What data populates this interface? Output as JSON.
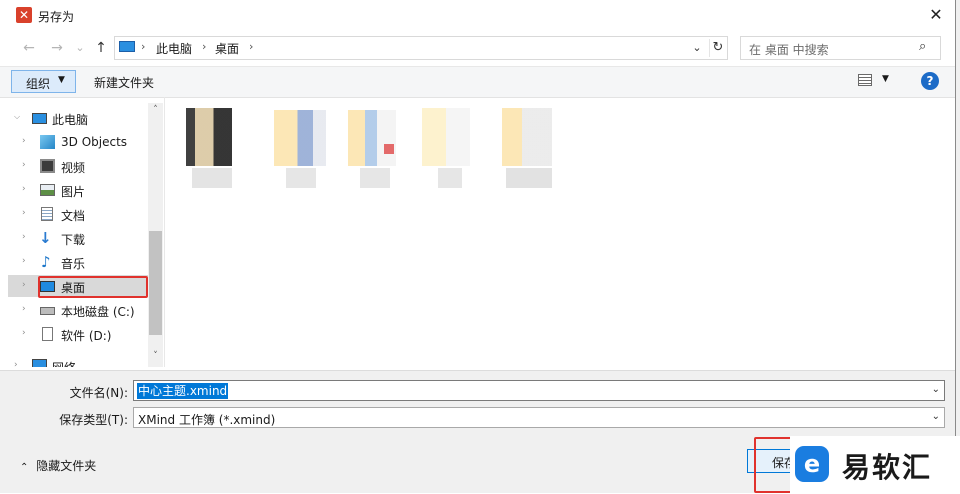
{
  "window": {
    "title": "另存为",
    "close": "✕"
  },
  "nav": {
    "back": "←",
    "forward": "→",
    "dropdown": "⌄",
    "up": "↑"
  },
  "address": {
    "crumbs": [
      "此电脑",
      "桌面"
    ],
    "sep": "›",
    "refresh": "↻",
    "dropdown": "⌄"
  },
  "search": {
    "placeholder": "在 桌面 中搜索",
    "icon": "⌕"
  },
  "toolbar": {
    "organize": "组织",
    "organize_arrow": "▼",
    "new_folder": "新建文件夹",
    "help": "?",
    "view_arrow": "▼"
  },
  "tree": {
    "items": [
      {
        "label": "此电脑",
        "icon": "pc-icon"
      },
      {
        "label": "3D Objects",
        "icon": "cube-icon"
      },
      {
        "label": "视频",
        "icon": "video-icon"
      },
      {
        "label": "图片",
        "icon": "picture-icon"
      },
      {
        "label": "文档",
        "icon": "document-icon"
      },
      {
        "label": "下载",
        "icon": "download-icon"
      },
      {
        "label": "音乐",
        "icon": "music-icon"
      },
      {
        "label": "桌面",
        "icon": "desktop-icon"
      },
      {
        "label": "本地磁盘 (C:)",
        "icon": "drive-icon"
      },
      {
        "label": "软件 (D:)",
        "icon": "drive-d-icon"
      },
      {
        "label": "网络",
        "icon": "network-icon"
      }
    ],
    "selected_label": "桌面"
  },
  "form": {
    "filename_label": "文件名(N):",
    "filename_value": "中心主题.xmind",
    "filetype_label": "保存类型(T):",
    "filetype_value": "XMind 工作簿 (*.xmind)"
  },
  "footer": {
    "hide_folders": "隐藏文件夹",
    "save": "保存"
  },
  "watermark": {
    "text": "易软汇",
    "icon": "e"
  },
  "colors": {
    "accent": "#0078d7",
    "highlight": "#e0322d",
    "app_icon": "#d9412b"
  }
}
